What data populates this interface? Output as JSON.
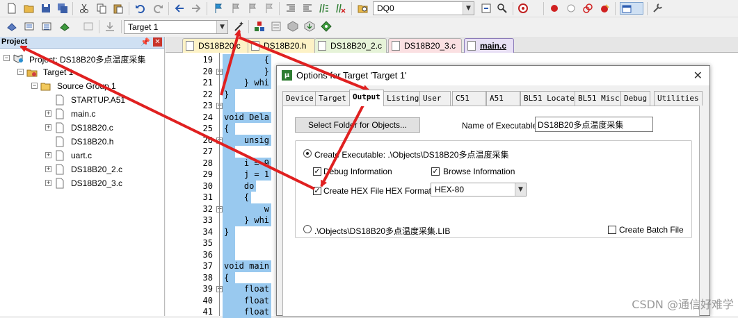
{
  "toolbar": {
    "target_combo": "Target 1",
    "search_combo": "DQ0"
  },
  "project_panel": {
    "title": "Project",
    "project_label": "Project: DS18B20多点温度采集",
    "target_label": "Target 1",
    "group_label": "Source Group 1",
    "files": [
      "STARTUP.A51",
      "main.c",
      "DS18B20.c",
      "DS18B20.h",
      "uart.c",
      "DS18B20_2.c",
      "DS18B20_3.c"
    ]
  },
  "file_tabs": [
    "DS18B20.c",
    "DS18B20.h",
    "DS18B20_2.c",
    "DS18B20_3.c",
    "main.c"
  ],
  "editor": {
    "line_numbers": [
      "19",
      "20",
      "21",
      "22",
      "23",
      "24",
      "25",
      "26",
      "27",
      "28",
      "29",
      "30",
      "31",
      "32",
      "33",
      "34",
      "35",
      "36",
      "37",
      "38",
      "39",
      "40",
      "41"
    ],
    "lines": [
      "        {",
      "        }",
      "    } whi",
      "}",
      "",
      "void Dela",
      "{",
      "    unsig",
      "",
      "    i = 9",
      "    j = 1",
      "    do",
      "    {",
      "        w",
      "    } whi",
      "}",
      "",
      "",
      "void main",
      "{",
      "    float",
      "    float",
      "    float"
    ]
  },
  "dialog": {
    "title": "Options for Target 'Target 1'",
    "close": "✕",
    "tabs": [
      "Device",
      "Target",
      "Output",
      "Listing",
      "User",
      "C51",
      "A51",
      "BL51 Locate",
      "BL51 Misc",
      "Debug",
      "Utilities"
    ],
    "select_folder_button": "Select Folder for Objects...",
    "name_of_executable_label": "Name of Executable:",
    "name_of_executable_value": "DS18B20多点温度采集",
    "create_executable_label": "Create Executable:  .\\Objects\\DS18B20多点温度采集",
    "debug_information_label": "Debug Information",
    "browse_information_label": "Browse Information",
    "create_hex_label": "Create HEX File",
    "hex_format_label": "HEX Format:",
    "hex_format_value": "HEX-80",
    "create_lib_label": ".\\Objects\\DS18B20多点温度采集.LIB",
    "create_batch_label": "Create Batch File",
    "debug_information_checked": true,
    "browse_information_checked": true,
    "create_hex_checked": true,
    "create_batch_checked": false
  },
  "watermark": "CSDN @通信好难学",
  "colors": {
    "selection": "#99c9ef",
    "arrow": "#e02020",
    "active_tab": "#e8e0f5"
  }
}
